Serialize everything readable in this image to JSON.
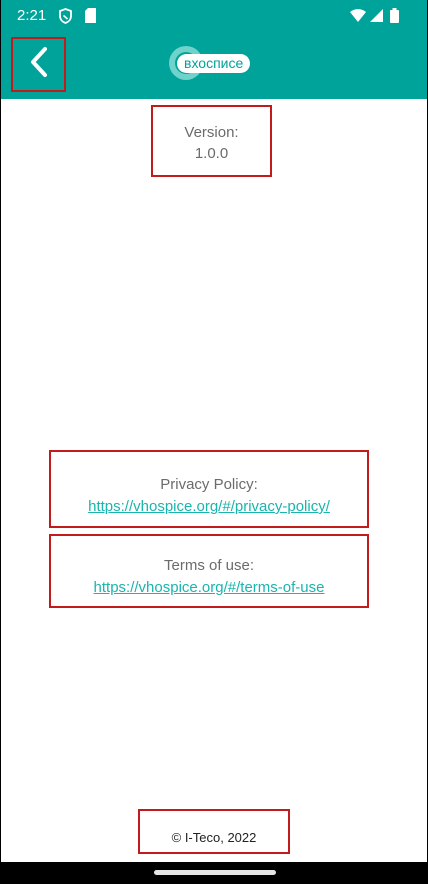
{
  "status_bar": {
    "time": "2:21",
    "icons": [
      "shield-icon",
      "sim-card-icon",
      "wifi-icon",
      "signal-icon",
      "battery-icon"
    ]
  },
  "app_bar": {
    "back_icon": "chevron-left-icon",
    "logo_text": "вхосписе"
  },
  "version": {
    "label": "Version:",
    "value": "1.0.0"
  },
  "privacy": {
    "label": "Privacy Policy:",
    "url": "https://vhospice.org/#/privacy-policy/"
  },
  "terms": {
    "label": "Terms of use:",
    "url": "https://vhospice.org/#/terms-of-use"
  },
  "footer": {
    "copyright": "© I-Teco, 2022"
  },
  "colors": {
    "primary": "#00a39a",
    "link": "#1ab5ad",
    "highlight_border": "#c11b1b"
  }
}
